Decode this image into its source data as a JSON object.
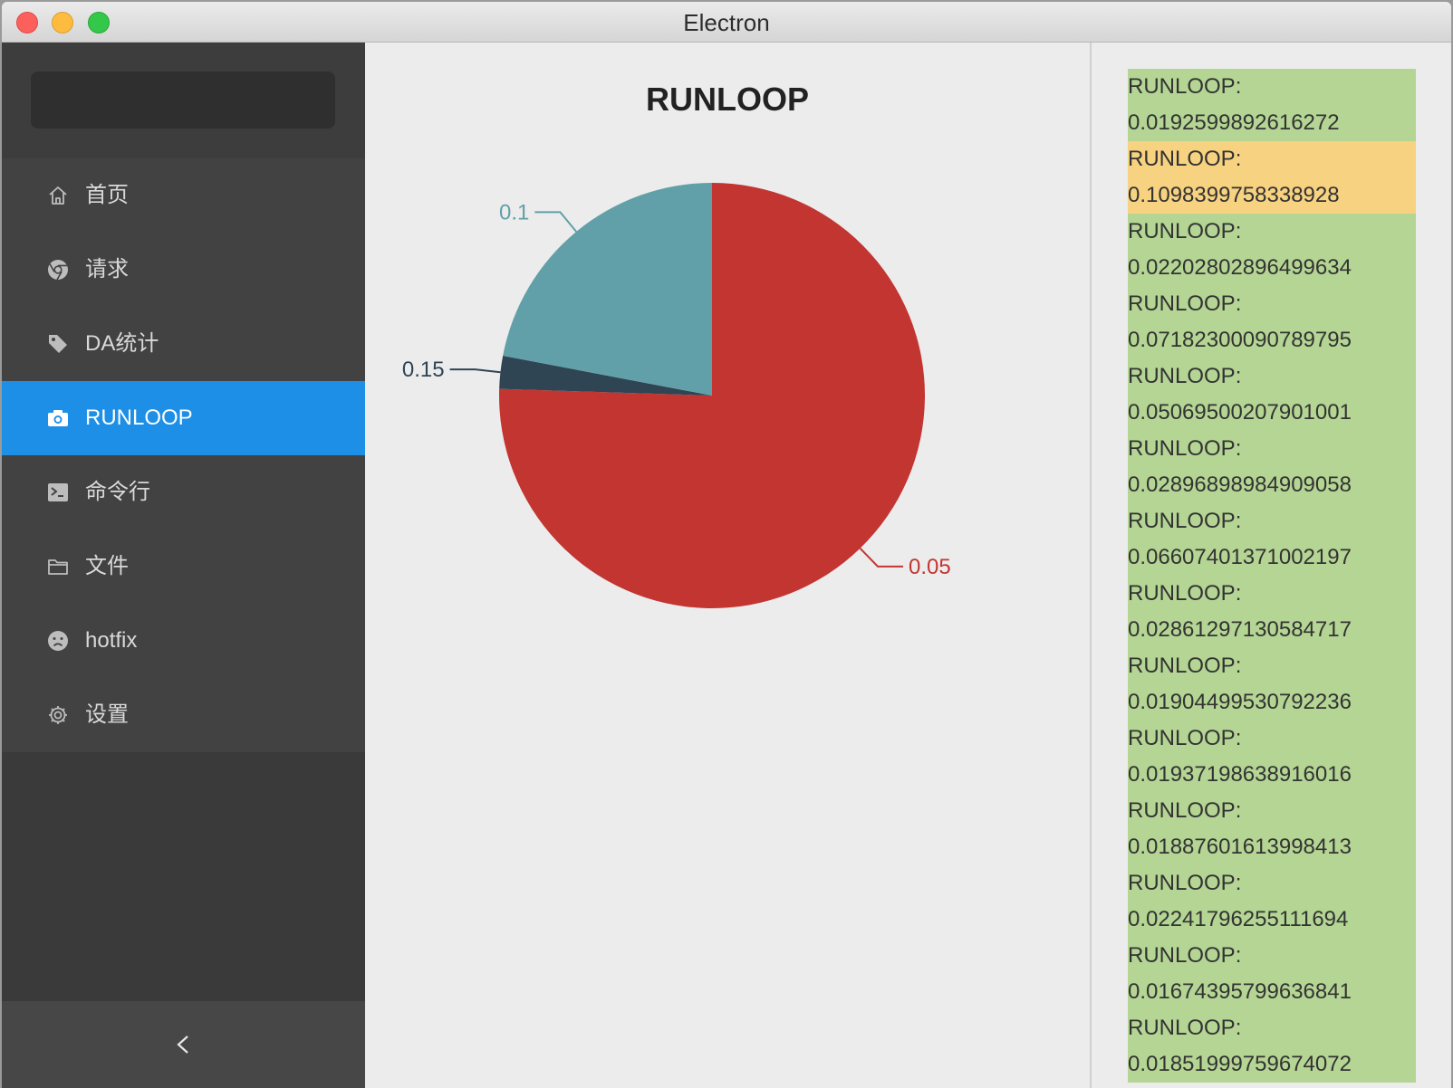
{
  "window": {
    "title": "Electron"
  },
  "sidebar": {
    "menu": [
      {
        "label": "首页",
        "icon": "home-icon"
      },
      {
        "label": "请求",
        "icon": "chrome-icon"
      },
      {
        "label": "DA统计",
        "icon": "tag-icon"
      },
      {
        "label": "RUNLOOP",
        "icon": "camera-icon",
        "active": true
      },
      {
        "label": "命令行",
        "icon": "terminal-icon"
      },
      {
        "label": "文件",
        "icon": "folder-icon"
      },
      {
        "label": "hotfix",
        "icon": "frown-icon"
      },
      {
        "label": "设置",
        "icon": "gear-icon"
      }
    ],
    "collapse_icon": "chevron-left-icon",
    "active_color": "#1e8fe6"
  },
  "chart": {
    "title": "RUNLOOP"
  },
  "chart_data": {
    "type": "pie",
    "title": "RUNLOOP",
    "slices": [
      {
        "label": "0.05",
        "value": 75.5,
        "color": "#c23531"
      },
      {
        "label": "0.15",
        "value": 2.5,
        "color": "#2f4554"
      },
      {
        "label": "0.1",
        "value": 22.0,
        "color": "#61a0a8"
      }
    ]
  },
  "log": {
    "label": "RUNLOOP:",
    "values": [
      "0.0192599892616272",
      "0.1098399758338928",
      "0.02202802896499634",
      "0.07182300090789795",
      "0.05069500207901001",
      "0.02896898984909058",
      "0.06607401371002197",
      "0.02861297130584717",
      "0.01904499530792236",
      "0.01937198638916016",
      "0.01887601613998413",
      "0.02241796255111694",
      "0.01674395799636841",
      "0.01851999759674072"
    ],
    "highlight_index": 1,
    "colors": {
      "normal": "#b4d593",
      "highlight": "#f7d280"
    }
  }
}
